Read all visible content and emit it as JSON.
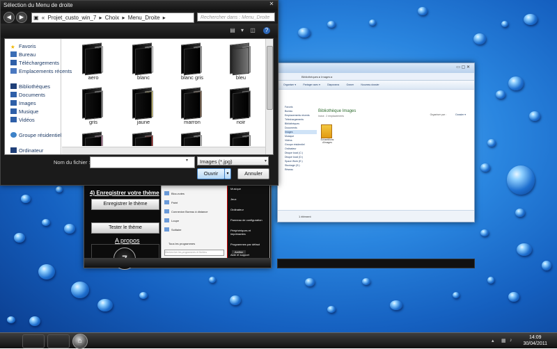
{
  "dialog": {
    "title": "Sélection du Menu de droite",
    "path_segments": [
      "Projet_custo_win_7",
      "Choix",
      "Menu_Droite"
    ],
    "search_placeholder": "Rechercher dans : Menu_Droite",
    "sidebar": [
      {
        "label": "Favoris",
        "icon": "star-icon"
      },
      {
        "label": "Bureau",
        "icon": "desktop-icon"
      },
      {
        "label": "Téléchargements",
        "icon": "downloads-icon"
      },
      {
        "label": "Emplacements récents",
        "icon": "recent-places-icon"
      },
      {
        "label": "Bibliothèques",
        "icon": "libraries-icon"
      },
      {
        "label": "Documents",
        "icon": "documents-icon"
      },
      {
        "label": "Images",
        "icon": "pictures-icon"
      },
      {
        "label": "Musique",
        "icon": "music-icon"
      },
      {
        "label": "Vidéos",
        "icon": "videos-icon"
      },
      {
        "label": "Groupe résidentiel",
        "icon": "homegroup-icon"
      },
      {
        "label": "Ordinateur",
        "icon": "computer-icon"
      }
    ],
    "files": [
      "aero",
      "blanc",
      "blanc gris",
      "bleu",
      "gris",
      "jaune",
      "marron",
      "noir",
      "",
      "",
      "",
      ""
    ],
    "filename_label": "Nom du fichier :",
    "filename_value": "",
    "filetype": "Images (*.jpg)",
    "open_label": "Ouvrir",
    "cancel_label": "Annuler"
  },
  "app": {
    "heading": "4) Enregistrer votre thème",
    "save_button": "Enregistrer le thème",
    "test_button": "Tester le thème",
    "about_link": "A propos",
    "logo": "7",
    "preview_right_items": [
      "Musique",
      "Jeux",
      "Ordinateur",
      "Panneau de configuration",
      "Périphériques et imprimantes",
      "Programmes par défaut",
      "Aide et support"
    ],
    "preview_left_items": [
      "Bloc-notes",
      "Paint",
      "Connexion Bureau à distance",
      "Loupe",
      "Solitaire"
    ],
    "preview_all_programs": "Tous les programmes",
    "preview_search": "Rechercher les programmes et fichiers",
    "preview_shutdown": "Arrêter"
  },
  "explorer": {
    "address": "Bibliothèques ▸ Images ▸",
    "commands": [
      "Organiser ▾",
      "Partager avec ▾",
      "Diaporama",
      "Graver",
      "Nouveau dossier"
    ],
    "nav": [
      "Favoris",
      "Bureau",
      "Emplacements récents",
      "Téléchargements",
      "Bibliothèques",
      "Documents",
      "Images",
      "Musique",
      "Vidéos",
      "Groupe résidentiel",
      "Ordinateur",
      "Disque local (C:)",
      "Disque local (D:)",
      "Space Work (E:)",
      "Stockage (G:)",
      "Réseau"
    ],
    "header": "Bibliothèque Images",
    "subheader": "Inclut : 2 emplacements",
    "arrange_label": "Organiser par :",
    "arrange_value": "Dossier ▾",
    "folder_label": "Échantillons d'images",
    "status": "1 élément"
  },
  "taskbar": {
    "time": "14:09",
    "date": "30/04/2011"
  }
}
